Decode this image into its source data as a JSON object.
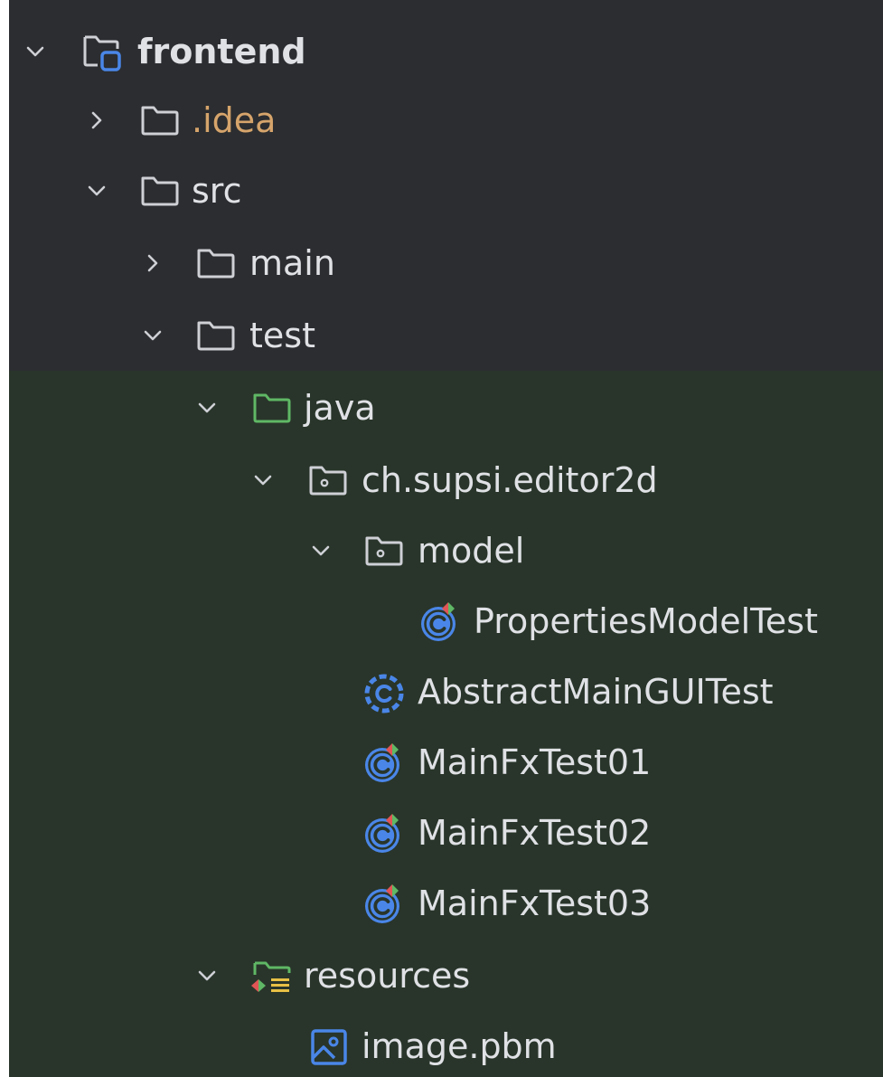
{
  "project_tree": {
    "root": {
      "label": "frontend",
      "expanded": true,
      "icon": "module-folder-icon"
    },
    "nodes": [
      {
        "id": "idea",
        "label": ".idea",
        "expanded": false,
        "icon": "folder-icon",
        "color": "#d6a46b"
      },
      {
        "id": "src",
        "label": "src",
        "expanded": true,
        "icon": "folder-icon"
      },
      {
        "id": "main",
        "label": "main",
        "expanded": false,
        "icon": "folder-icon"
      },
      {
        "id": "test",
        "label": "test",
        "expanded": true,
        "icon": "folder-icon"
      },
      {
        "id": "java",
        "label": "java",
        "expanded": true,
        "icon": "test-sources-folder-icon",
        "color": "#5fb865"
      },
      {
        "id": "pkg",
        "label": "ch.supsi.editor2d",
        "expanded": true,
        "icon": "package-icon"
      },
      {
        "id": "model",
        "label": "model",
        "expanded": true,
        "icon": "package-icon"
      },
      {
        "id": "propTest",
        "label": "PropertiesModelTest",
        "icon": "test-class-icon"
      },
      {
        "id": "abstractGui",
        "label": "AbstractMainGUITest",
        "icon": "abstract-class-icon"
      },
      {
        "id": "fx1",
        "label": "MainFxTest01",
        "icon": "test-class-icon"
      },
      {
        "id": "fx2",
        "label": "MainFxTest02",
        "icon": "test-class-icon"
      },
      {
        "id": "fx3",
        "label": "MainFxTest03",
        "icon": "test-class-icon"
      },
      {
        "id": "resources",
        "label": "resources",
        "expanded": true,
        "icon": "test-resources-folder-icon"
      },
      {
        "id": "image",
        "label": "image.pbm",
        "icon": "image-file-icon"
      }
    ]
  },
  "colors": {
    "background": "#2b2d30",
    "test_area_background": "#29352a",
    "text": "#dfe1e5",
    "excluded_folder_text": "#d6a46b",
    "class_icon": "#4a86e8",
    "test_folder": "#5fb865"
  }
}
